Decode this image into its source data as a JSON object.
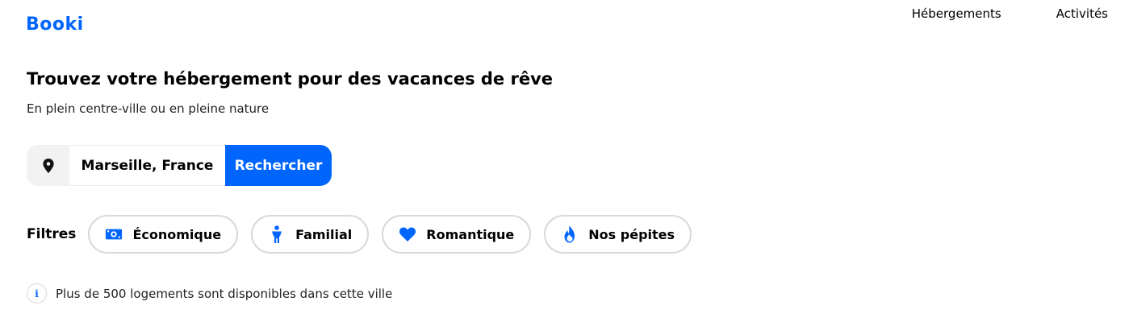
{
  "brand": {
    "name": "Booki",
    "accent": "#0065FC"
  },
  "nav": {
    "items": [
      "Hébergements",
      "Activités"
    ]
  },
  "hero": {
    "title": "Trouvez votre hébergement pour des vacances de rêve",
    "subtitle": "En plein centre-ville ou en pleine nature"
  },
  "search": {
    "icon": "location-pin-icon",
    "location": "Marseille, France",
    "button_label": "Rechercher"
  },
  "filters": {
    "label": "Filtres",
    "items": [
      {
        "label": "Économique",
        "icon": "money-bill-icon"
      },
      {
        "label": "Familial",
        "icon": "child-icon"
      },
      {
        "label": "Romantique",
        "icon": "heart-icon"
      },
      {
        "label": "Nos pépites",
        "icon": "fire-icon"
      }
    ]
  },
  "info": {
    "icon": "info-icon",
    "glyph": "i",
    "text": "Plus de 500 logements sont disponibles dans cette ville"
  }
}
